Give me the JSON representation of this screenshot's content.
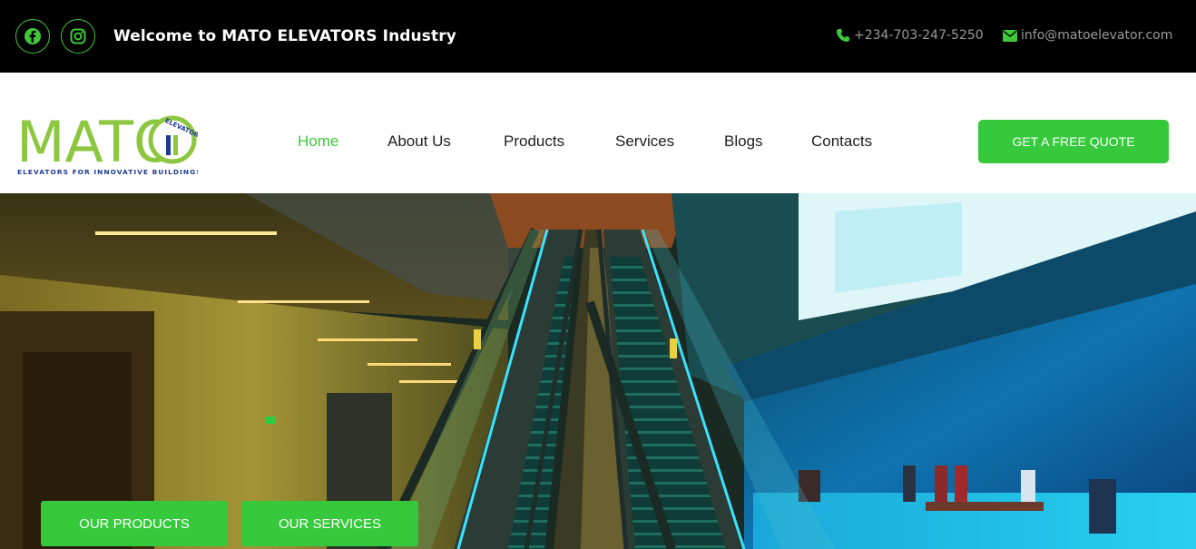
{
  "topbar": {
    "welcome": "Welcome to MATO ELEVATORS Industry",
    "phone": "+234-703-247-5250",
    "email": "info@matoelevator.com",
    "social": [
      {
        "icon": "facebook-icon"
      },
      {
        "icon": "instagram-icon"
      }
    ]
  },
  "logo": {
    "name": "MATO",
    "badge": "ELEVATOR",
    "tagline": "ELEVATORS FOR INNOVATIVE BUILDINGS"
  },
  "nav": {
    "items": [
      {
        "label": "Home",
        "active": true
      },
      {
        "label": "About Us",
        "active": false
      },
      {
        "label": "Products",
        "active": false
      },
      {
        "label": "Services",
        "active": false
      },
      {
        "label": "Blogs",
        "active": false
      },
      {
        "label": "Contacts",
        "active": false
      }
    ],
    "cta": "GET A FREE QUOTE"
  },
  "hero": {
    "buttons": {
      "products": "OUR PRODUCTS",
      "services": "OUR SERVICES"
    }
  },
  "colors": {
    "accent": "#35c93b",
    "topbar_bg": "#000000",
    "text_dark": "#1e1e1e"
  }
}
